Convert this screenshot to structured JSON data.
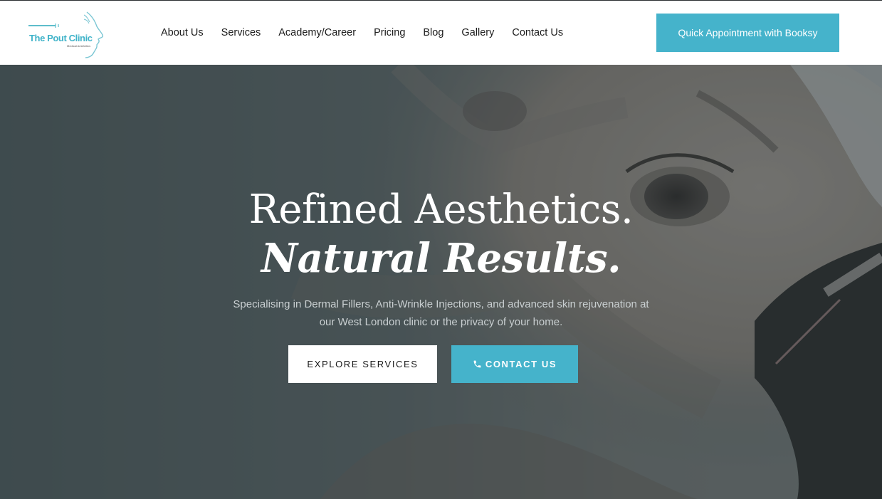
{
  "brand": {
    "name": "The Pout Clinic",
    "tagline": "Medical Aesthetics",
    "accent_color": "#45b3cb"
  },
  "nav": {
    "items": [
      "About Us",
      "Services",
      "Academy/Career",
      "Pricing",
      "Blog",
      "Gallery",
      "Contact Us"
    ]
  },
  "header": {
    "cta_label": "Quick Appointment with Booksy"
  },
  "hero": {
    "headline_line1": "Refined Aesthetics.",
    "headline_line2": "Natural Results.",
    "subtitle": "Specialising in Dermal Fillers, Anti-Wrinkle Injections, and advanced skin rejuvenation at our West London clinic or the privacy of your home.",
    "primary_button": "EXPLORE SERVICES",
    "secondary_button": "CONTACT US",
    "secondary_button_icon": "phone-icon"
  }
}
